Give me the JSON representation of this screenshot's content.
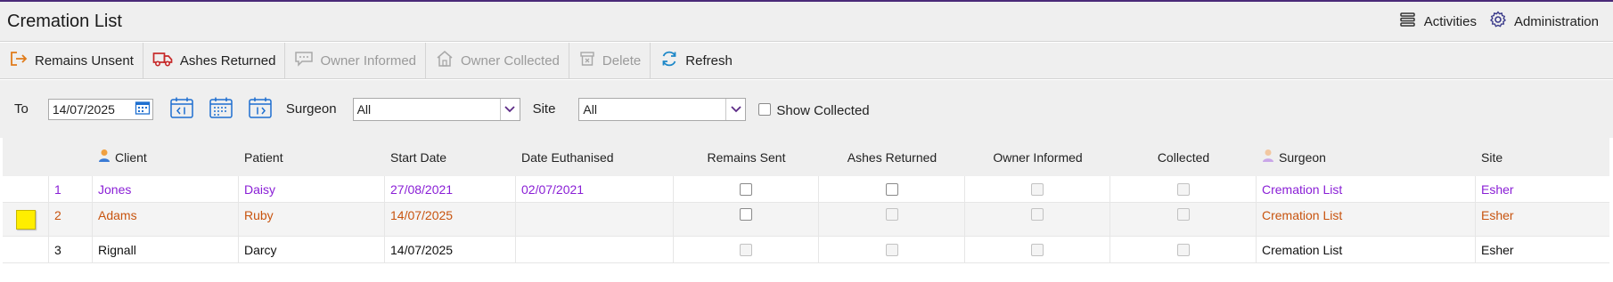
{
  "app": {
    "title": "Cremation List",
    "activities_label": "Activities",
    "administration_label": "Administration"
  },
  "toolbar": {
    "remains_unsent": "Remains Unsent",
    "ashes_returned": "Ashes Returned",
    "owner_informed": "Owner Informed",
    "owner_collected": "Owner Collected",
    "delete": "Delete",
    "refresh": "Refresh"
  },
  "filters": {
    "to_label": "To",
    "to_date": "14/07/2025",
    "surgeon_label": "Surgeon",
    "surgeon_value": "All",
    "site_label": "Site",
    "site_value": "All",
    "show_collected_label": "Show Collected",
    "show_collected_checked": false
  },
  "grid": {
    "headers": {
      "client": "Client",
      "patient": "Patient",
      "start_date": "Start Date",
      "date_euthanised": "Date Euthanised",
      "remains_sent": "Remains Sent",
      "ashes_returned": "Ashes Returned",
      "owner_informed": "Owner Informed",
      "collected": "Collected",
      "surgeon": "Surgeon",
      "site": "Site"
    },
    "rows": [
      {
        "num": "1",
        "client": "Jones",
        "patient": "Daisy",
        "start_date": "27/08/2021",
        "date_euthanised": "02/07/2021",
        "surgeon": "Cremation List",
        "site": "Esher",
        "text_color": "#8a1fd6",
        "flag_color": null
      },
      {
        "num": "2",
        "client": "Adams",
        "patient": "Ruby",
        "start_date": "14/07/2025",
        "date_euthanised": "",
        "surgeon": "Cremation List",
        "site": "Esher",
        "text_color": "#c8540f",
        "flag_color": "#ffee00"
      },
      {
        "num": "3",
        "client": "Rignall",
        "patient": "Darcy",
        "start_date": "14/07/2025",
        "date_euthanised": "",
        "surgeon": "Cremation List",
        "site": "Esher",
        "text_color": "#111111",
        "flag_color": null
      }
    ]
  },
  "icons": {
    "activities": "list-icon",
    "administration": "gear-icon",
    "remains_unsent": "exit-arrow-icon",
    "ashes_returned": "truck-icon",
    "owner_informed": "chat-icon",
    "owner_collected": "home-icon",
    "delete": "trash-icon",
    "refresh": "refresh-icon",
    "calendar": "calendar-icon",
    "client_header": "client-person-icon",
    "surgeon_header": "surgeon-person-icon"
  }
}
